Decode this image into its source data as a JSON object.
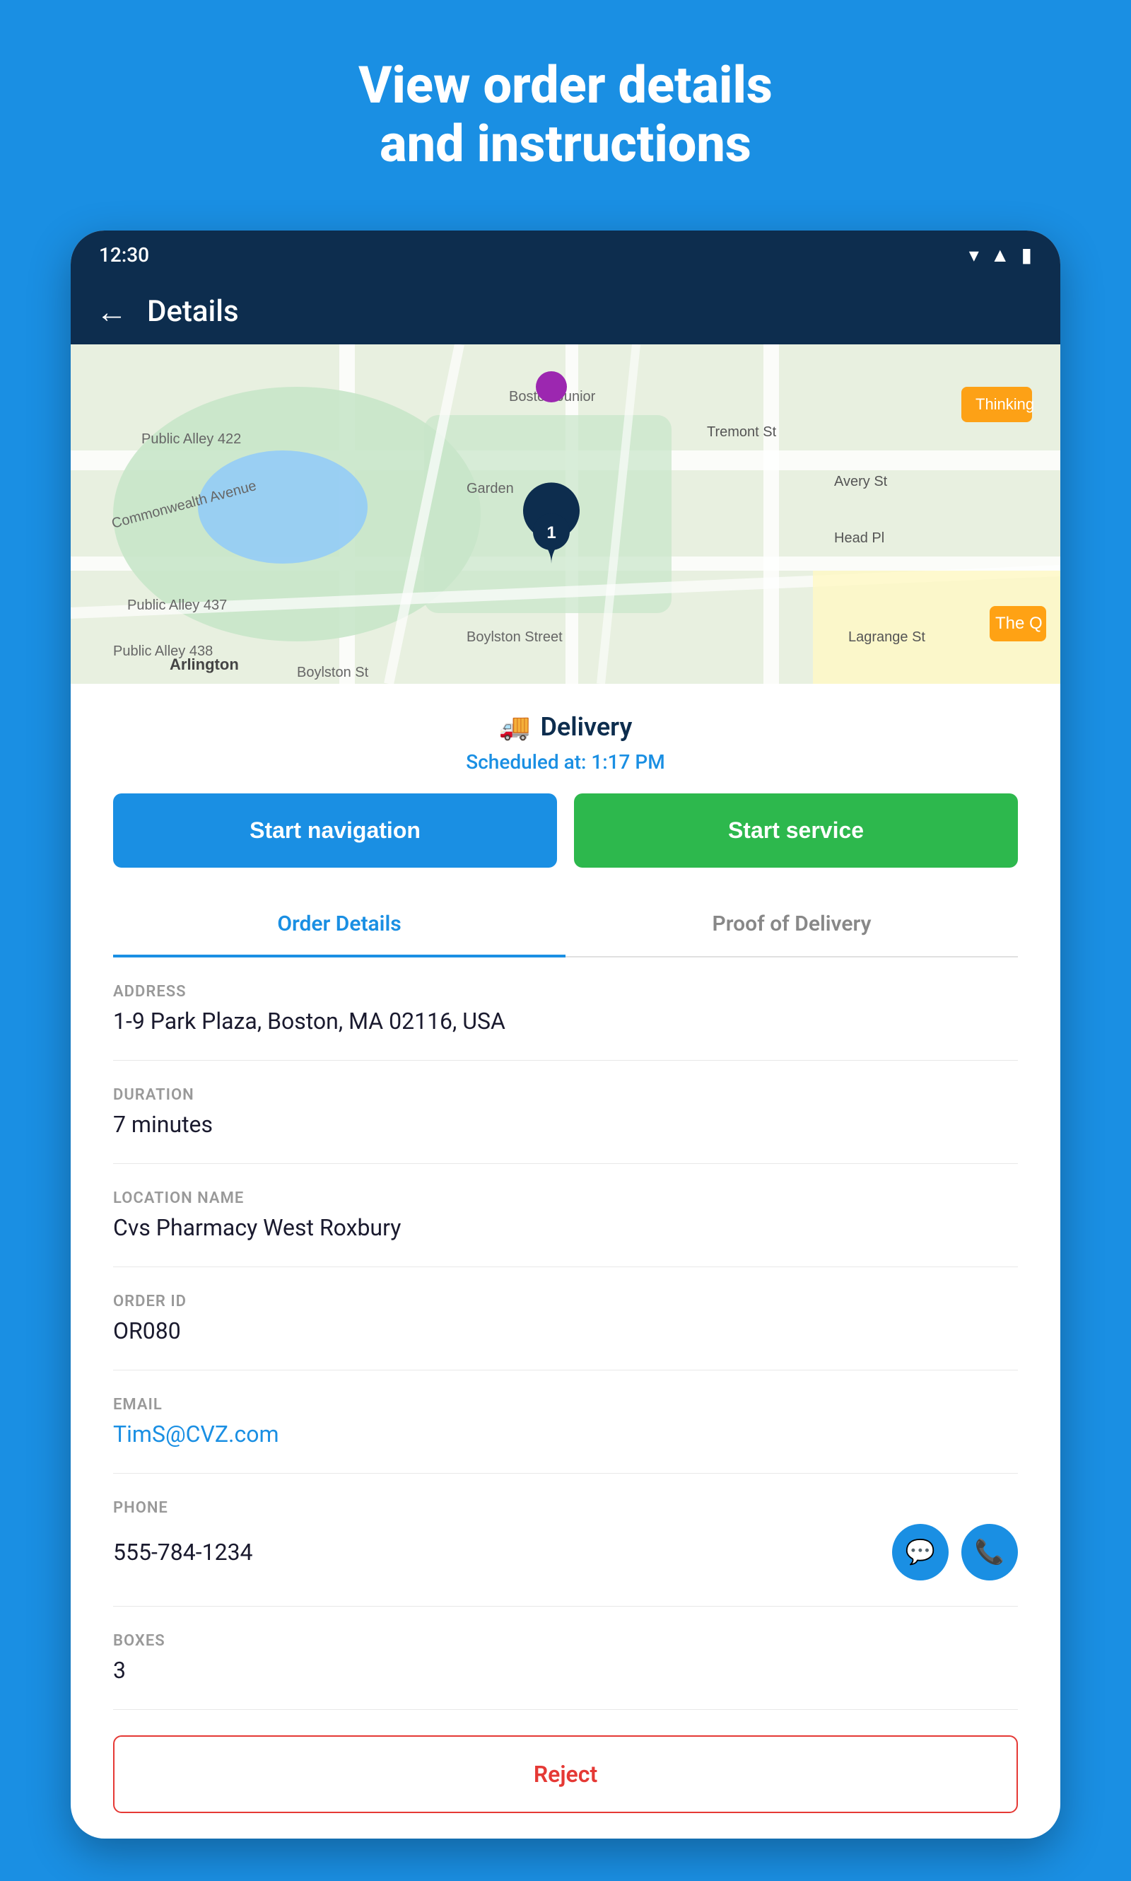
{
  "page": {
    "title_line1": "View order details",
    "title_line2": "and instructions",
    "bg_color": "#1a8fe3"
  },
  "status_bar": {
    "time": "12:30"
  },
  "nav": {
    "back_label": "←",
    "title": "Details"
  },
  "delivery": {
    "icon": "🚚",
    "label": "Delivery",
    "scheduled_prefix": "Scheduled at:",
    "scheduled_time": "1:17 PM"
  },
  "buttons": {
    "start_navigation": "Start navigation",
    "start_service": "Start service"
  },
  "tabs": [
    {
      "label": "Order Details",
      "active": true
    },
    {
      "label": "Proof of Delivery",
      "active": false
    }
  ],
  "details": {
    "address_label": "ADDRESS",
    "address_value": "1-9 Park Plaza, Boston, MA 02116, USA",
    "duration_label": "DURATION",
    "duration_value": "7 minutes",
    "location_name_label": "LOCATION NAME",
    "location_name_value": "Cvs Pharmacy West Roxbury",
    "order_id_label": "ORDER ID",
    "order_id_value": "OR080",
    "email_label": "EMAIL",
    "email_value": "TimS@CVZ.com",
    "phone_label": "PHONE",
    "phone_value": "555-784-1234",
    "boxes_label": "BOXES",
    "boxes_value": "3"
  },
  "footer": {
    "reject_label": "Reject"
  }
}
